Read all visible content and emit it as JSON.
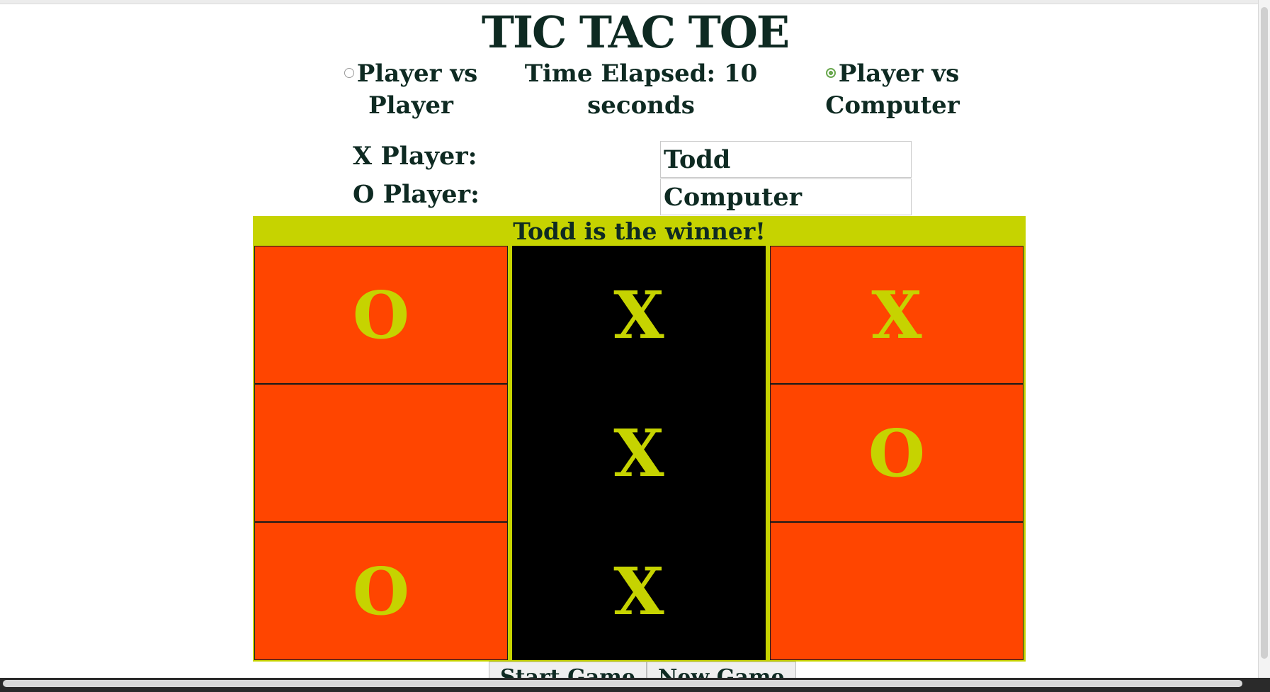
{
  "page": {
    "title": "TIC TAC TOE"
  },
  "modes": {
    "pvp_label": "Player vs Player",
    "pvc_label": "Player vs Computer",
    "selected": "Player vs Computer"
  },
  "timer": {
    "text": "Time Elapsed: 10 seconds"
  },
  "players": {
    "x_label": "X Player:",
    "x_value": "Todd",
    "o_label": "O Player:",
    "o_value": "Computer"
  },
  "status": {
    "message": "Todd is the winner!"
  },
  "board": {
    "cells": [
      "O",
      "X",
      "X",
      "",
      "X",
      "O",
      "O",
      "X",
      ""
    ],
    "winning_cells": [
      1,
      4,
      7
    ]
  },
  "buttons": {
    "start_label": "Start Game",
    "new_label": "New Game"
  },
  "colors": {
    "cell_bg": "#ff4500",
    "win_bg": "#000000",
    "mark": "#c6d300",
    "banner": "#c6d300",
    "text": "#0e2a22"
  }
}
